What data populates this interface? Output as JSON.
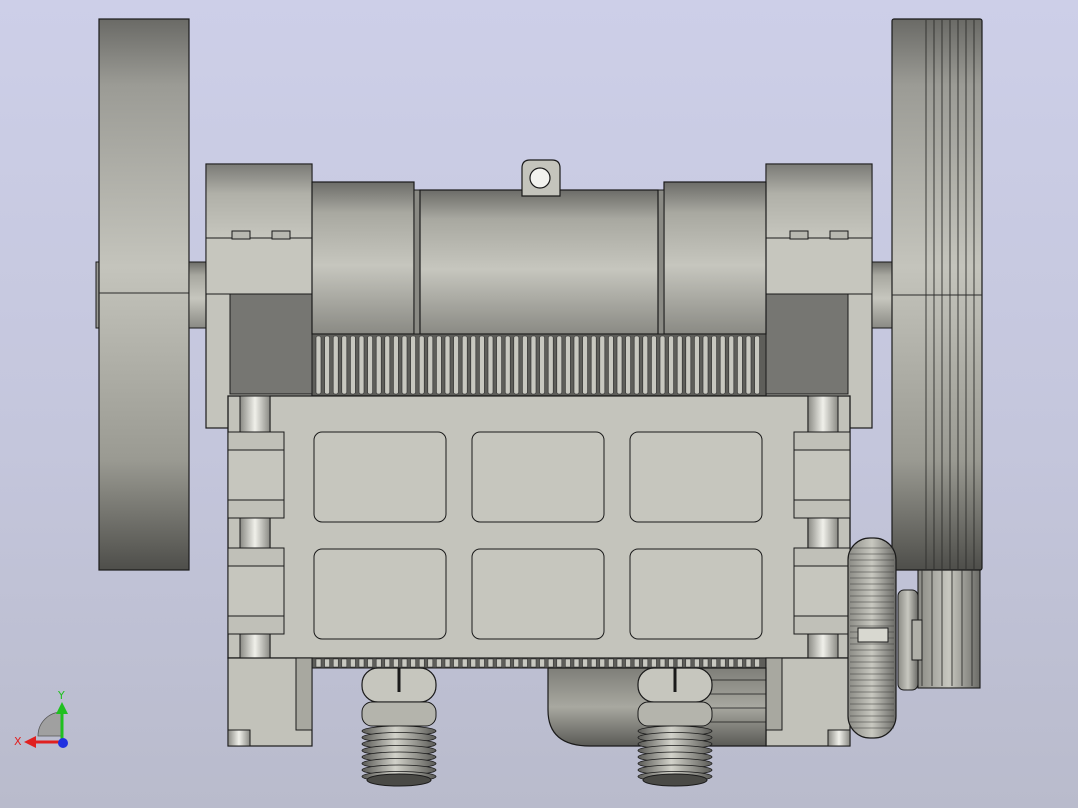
{
  "viewport": {
    "background_top": "#cdcfe8",
    "background_bottom": "#b9bbcc",
    "model_colors": {
      "body": "#c2c2ba",
      "shadow": "#6f6f6a",
      "edge": "#1a1a1a"
    }
  },
  "triad": {
    "x_label": "X",
    "y_label": "Y",
    "x_color": "#e02020",
    "y_color": "#20c020",
    "z_color": "#2030e0"
  }
}
